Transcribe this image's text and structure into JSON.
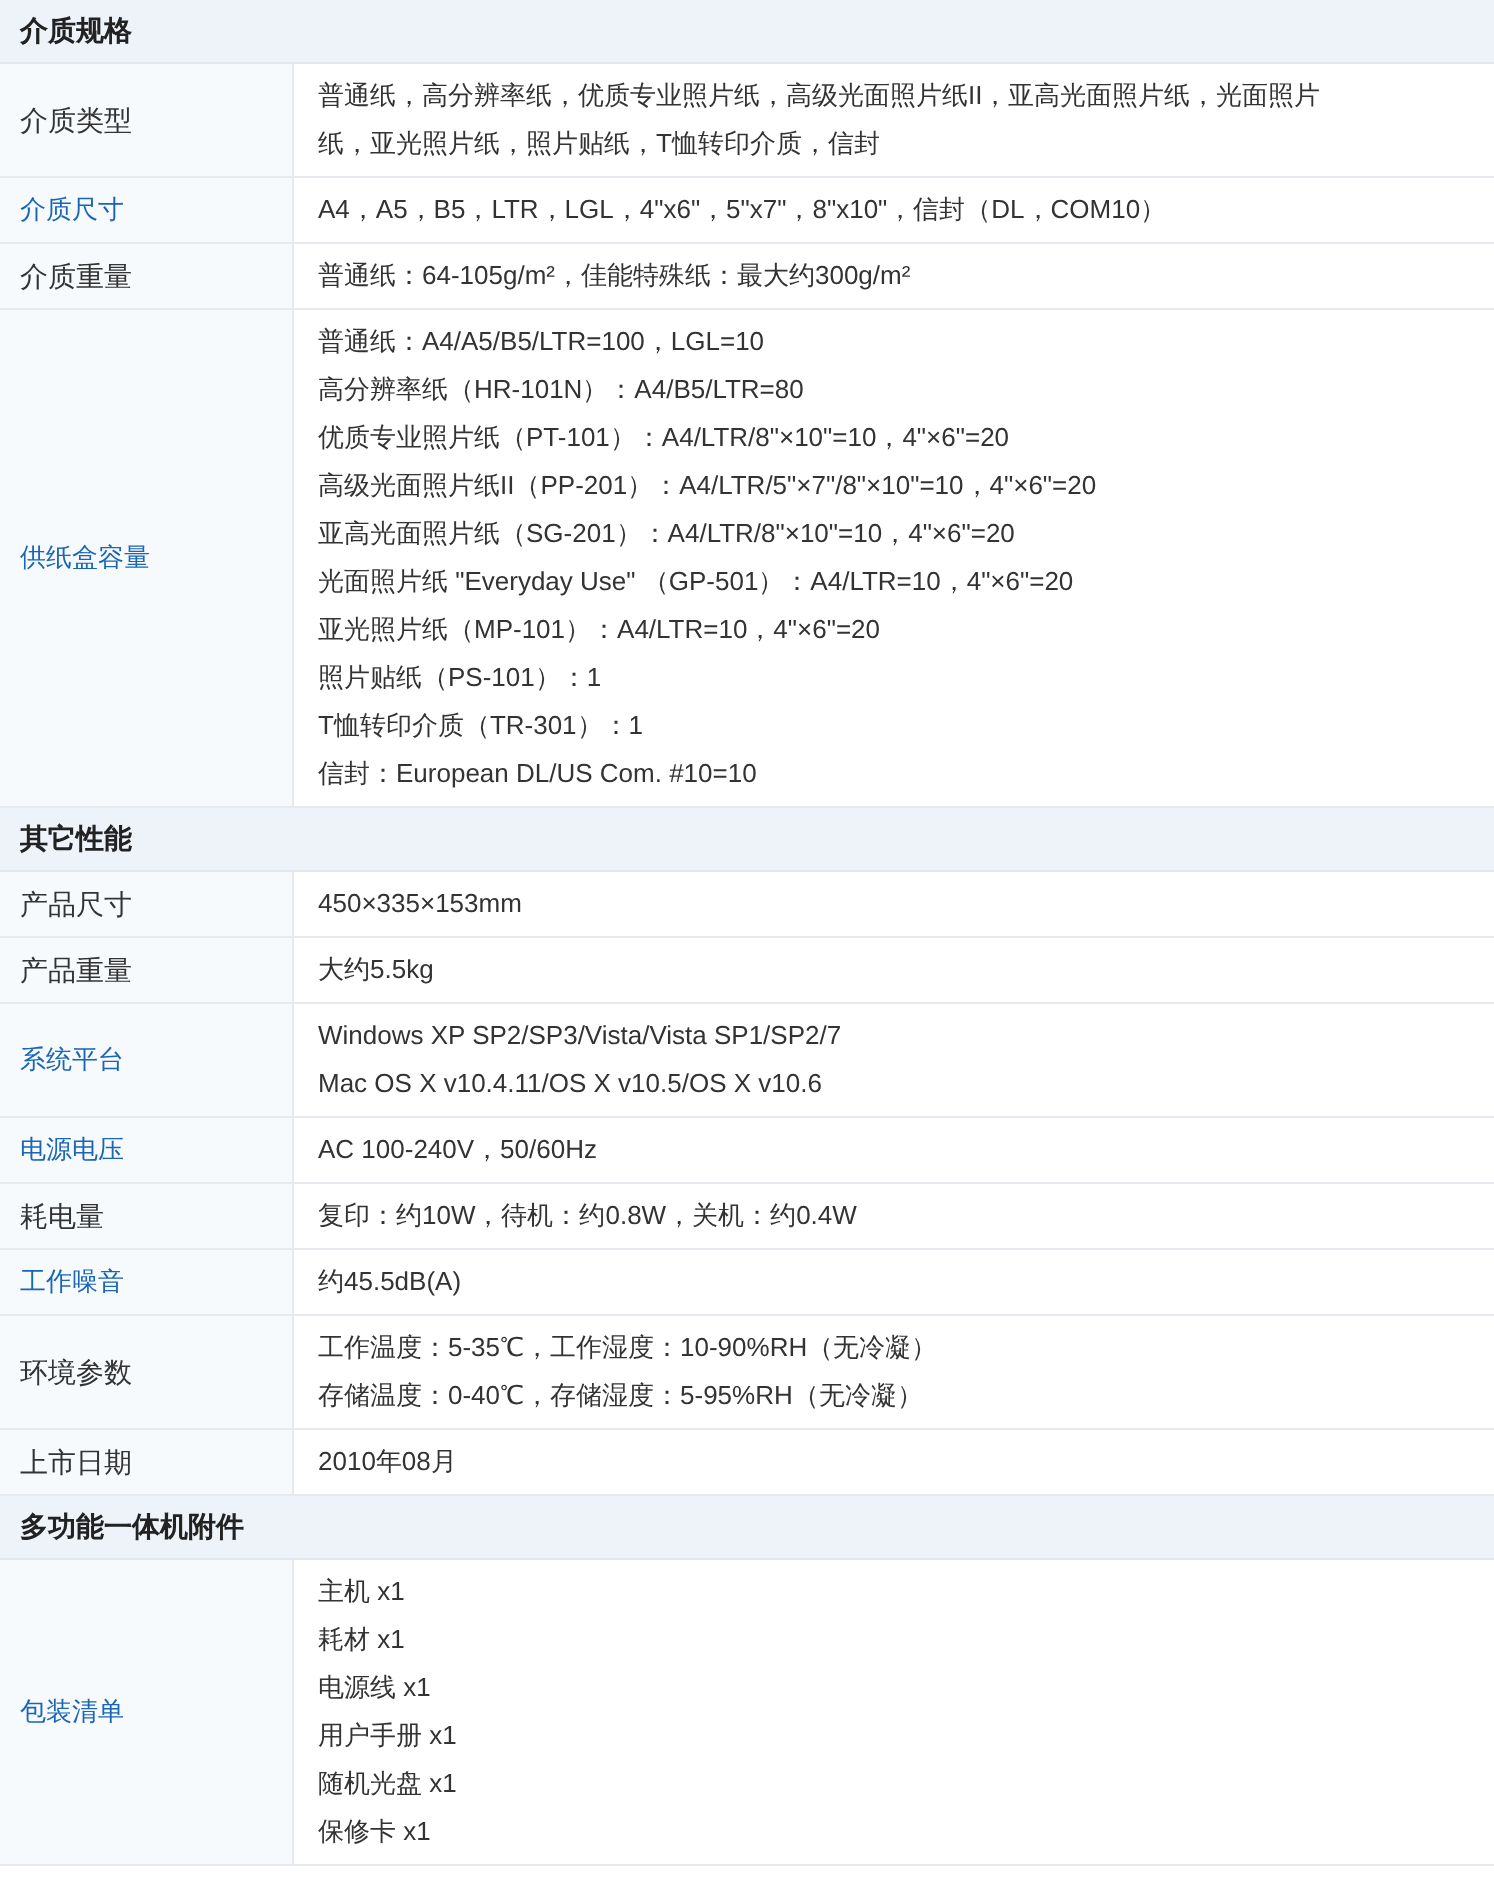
{
  "sections": [
    {
      "title": "介质规格",
      "rows": [
        {
          "label": "介质类型",
          "link": false,
          "lines": [
            "普通纸，高分辨率纸，优质专业照片纸，高级光面照片纸II，亚高光面照片纸，光面照片纸，亚光照片纸，照片贴纸，T恤转印介质，信封"
          ]
        },
        {
          "label": "介质尺寸",
          "link": true,
          "lines": [
            "A4，A5，B5，LTR，LGL，4\"x6\"，5\"x7\"，8\"x10\"，信封（DL，COM10）"
          ]
        },
        {
          "label": "介质重量",
          "link": false,
          "lines": [
            "普通纸：64-105g/m²，佳能特殊纸：最大约300g/m²"
          ]
        },
        {
          "label": "供纸盒容量",
          "link": true,
          "lines": [
            "普通纸：A4/A5/B5/LTR=100，LGL=10",
            "高分辨率纸（HR-101N）：A4/B5/LTR=80",
            "优质专业照片纸（PT-101）：A4/LTR/8\"×10\"=10，4\"×6\"=20",
            "高级光面照片纸II（PP-201）：A4/LTR/5\"×7\"/8\"×10\"=10，4\"×6\"=20",
            "亚高光面照片纸（SG-201）：A4/LTR/8\"×10\"=10，4\"×6\"=20",
            "光面照片纸 \"Everyday Use\" （GP-501）：A4/LTR=10，4\"×6\"=20",
            "亚光照片纸（MP-101）：A4/LTR=10，4\"×6\"=20",
            "照片贴纸（PS-101）：1",
            "T恤转印介质（TR-301）：1",
            "信封：European DL/US Com. #10=10"
          ]
        }
      ]
    },
    {
      "title": "其它性能",
      "rows": [
        {
          "label": "产品尺寸",
          "link": false,
          "lines": [
            "450×335×153mm"
          ]
        },
        {
          "label": "产品重量",
          "link": false,
          "lines": [
            "大约5.5kg"
          ]
        },
        {
          "label": "系统平台",
          "link": true,
          "lines": [
            "Windows XP SP2/SP3/Vista/Vista SP1/SP2/7",
            "Mac OS X v10.4.11/OS X v10.5/OS X v10.6"
          ]
        },
        {
          "label": "电源电压",
          "link": true,
          "lines": [
            "AC 100-240V，50/60Hz"
          ]
        },
        {
          "label": "耗电量",
          "link": false,
          "lines": [
            "复印：约10W，待机：约0.8W，关机：约0.4W"
          ]
        },
        {
          "label": "工作噪音",
          "link": true,
          "lines": [
            "约45.5dB(A)"
          ]
        },
        {
          "label": "环境参数",
          "link": false,
          "lines": [
            "工作温度：5-35℃，工作湿度：10-90%RH（无冷凝）",
            "存储温度：0-40℃，存储湿度：5-95%RH（无冷凝）"
          ]
        },
        {
          "label": "上市日期",
          "link": false,
          "lines": [
            "2010年08月"
          ]
        }
      ]
    },
    {
      "title": "多功能一体机附件",
      "rows": [
        {
          "label": "包装清单",
          "link": true,
          "lines": [
            "主机 x1",
            "耗材 x1",
            "电源线 x1",
            "用户手册 x1",
            "随机光盘 x1",
            "保修卡 x1"
          ]
        }
      ]
    }
  ]
}
